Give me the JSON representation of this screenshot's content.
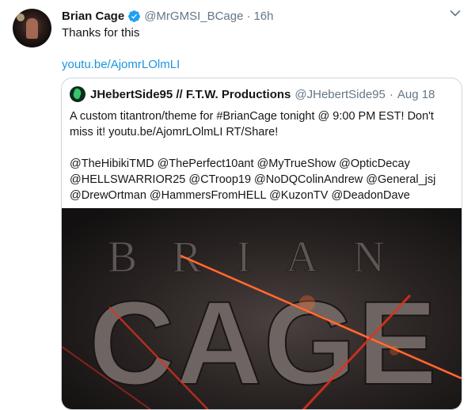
{
  "tweet": {
    "author_name": "Brian Cage",
    "handle": "@MrGMSI_BCage",
    "separator": "·",
    "time": "16h",
    "text": "Thanks for this",
    "link": "youtu.be/AjomrLOlmLI"
  },
  "quoted": {
    "author_name": "JHebertSide95 // F.T.W. Productions",
    "handle": "@JHebertSide95",
    "separator": "·",
    "date": "Aug 18",
    "line1": "A custom titantron/theme for #BrianCage tonight @ 9:00 PM EST! Don't",
    "line2": "miss it! youtu.be/AjomrLOlmLI RT/Share!",
    "mentions1": "@TheHibikiTMD @ThePerfect10ant @MyTrueShow @OpticDecay",
    "mentions2": "@HELLSWARRIOR25 @CTroop19 @NoDQColinAndrew @General_jsj",
    "mentions3": "@DrewOrtman @HammersFromHELL @KuzonTV @DeadonDave",
    "media": {
      "word1": "BRIAN",
      "word2": "CAGE"
    }
  },
  "colors": {
    "link": "#1b95e0",
    "muted": "#657786",
    "verified": "#1da1f2",
    "slash": "#e0321e"
  },
  "icons": [
    "verified-badge-icon",
    "chevron-down-icon"
  ]
}
